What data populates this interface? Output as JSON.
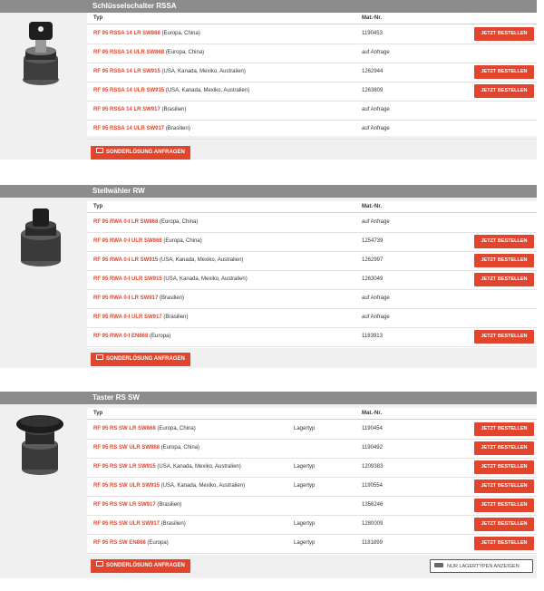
{
  "colors": {
    "accent": "#e1452d",
    "header_bg": "#8c8c8c",
    "panel_bg": "#f0f0f0"
  },
  "sections": [
    {
      "title": "Schlüsselschalter RSSA",
      "headers": {
        "typ": "Typ",
        "matnr": "Mat.-Nr."
      },
      "rows": [
        {
          "code": "RF 95 RSSA 14 LR SW868",
          "region": "(Europa, China)",
          "lagertyp": "",
          "matnr": "1190453",
          "button": "JETZT BESTELLEN"
        },
        {
          "code": "RF 95 RSSA 14 ULR SW868",
          "region": "(Europa, China)",
          "lagertyp": "",
          "matnr": "auf Anfrage",
          "button": ""
        },
        {
          "code": "RF 95 RSSA 14 LR SW915",
          "region": "(USA, Kanada, Mexiko, Australien)",
          "lagertyp": "",
          "matnr": "1262944",
          "button": "JETZT BESTELLEN"
        },
        {
          "code": "RF 95 RSSA 14 ULR SW915",
          "region": "(USA, Kanada, Mexiko, Australien)",
          "lagertyp": "",
          "matnr": "1263809",
          "button": "JETZT BESTELLEN"
        },
        {
          "code": "RF 95 RSSA 14 LR SW917",
          "region": "(Brasilien)",
          "lagertyp": "",
          "matnr": "auf Anfrage",
          "button": ""
        },
        {
          "code": "RF 95 RSSA 14 ULR SW917",
          "region": "(Brasilien)",
          "lagertyp": "",
          "matnr": "auf Anfrage",
          "button": ""
        }
      ],
      "request_label": "SONDERLÖSUNG ANFRAGEN"
    },
    {
      "title": "Stellwähler RW",
      "headers": {
        "typ": "Typ",
        "matnr": "Mat.-Nr."
      },
      "rows": [
        {
          "code": "RF 95 RWA 0-I LR SW868",
          "region": "(Europa, China)",
          "lagertyp": "",
          "matnr": "auf Anfrage",
          "button": ""
        },
        {
          "code": "RF 95 RWA 0-I ULR SW868",
          "region": "(Europa, China)",
          "lagertyp": "",
          "matnr": "1254739",
          "button": "JETZT BESTELLEN"
        },
        {
          "code": "RF 95 RWA 0-I LR SW915",
          "region": "(USA, Kanada, Mexiko, Australien)",
          "lagertyp": "",
          "matnr": "1262997",
          "button": "JETZT BESTELLEN"
        },
        {
          "code": "RF 95 RWA 0-I ULR SW915",
          "region": "(USA, Kanada, Mexiko, Australien)",
          "lagertyp": "",
          "matnr": "1263049",
          "button": "JETZT BESTELLEN"
        },
        {
          "code": "RF 95 RWA 0-I LR SW917",
          "region": "(Brasilien)",
          "lagertyp": "",
          "matnr": "auf Anfrage",
          "button": ""
        },
        {
          "code": "RF 95 RWA 0-I ULR SW917",
          "region": "(Brasilien)",
          "lagertyp": "",
          "matnr": "auf Anfrage",
          "button": ""
        },
        {
          "code": "RF 95 RWA 0-I EN868",
          "region": "(Europa)",
          "lagertyp": "",
          "matnr": "1183913",
          "button": "JETZT BESTELLEN"
        }
      ],
      "request_label": "SONDERLÖSUNG ANFRAGEN"
    },
    {
      "title": "Taster RS SW",
      "headers": {
        "typ": "Typ",
        "matnr": "Mat.-Nr."
      },
      "rows": [
        {
          "code": "RF 95 RS SW LR SW868",
          "region": "(Europa, China)",
          "lagertyp": "Lagertyp",
          "matnr": "1190454",
          "button": "JETZT BESTELLEN"
        },
        {
          "code": "RF 95 RS SW ULR SW868",
          "region": "(Europa, China)",
          "lagertyp": "",
          "matnr": "1190492",
          "button": "JETZT BESTELLEN"
        },
        {
          "code": "RF 95 RS SW LR SW915",
          "region": "(USA, Kanada, Mexiko, Australien)",
          "lagertyp": "Lagertyp",
          "matnr": "1209383",
          "button": "JETZT BESTELLEN"
        },
        {
          "code": "RF 95 RS SW ULR SW915",
          "region": "(USA, Kanada, Mexiko, Australien)",
          "lagertyp": "Lagertyp",
          "matnr": "1190554",
          "button": "JETZT BESTELLEN"
        },
        {
          "code": "RF 95 RS SW LR SW917",
          "region": "(Brasilien)",
          "lagertyp": "",
          "matnr": "1356246",
          "button": "JETZT BESTELLEN"
        },
        {
          "code": "RF 95 RS SW ULR SW917",
          "region": "(Brasilien)",
          "lagertyp": "Lagertyp",
          "matnr": "1280009",
          "button": "JETZT BESTELLEN"
        },
        {
          "code": "RF 95 RS SW EN868",
          "region": "(Europa)",
          "lagertyp": "Lagertyp",
          "matnr": "1181899",
          "button": "JETZT BESTELLEN"
        }
      ],
      "request_label": "SONDERLÖSUNG ANFRAGEN",
      "stock_filter_label": "NUR LAGERTYPEN ANZEIGEN"
    }
  ]
}
